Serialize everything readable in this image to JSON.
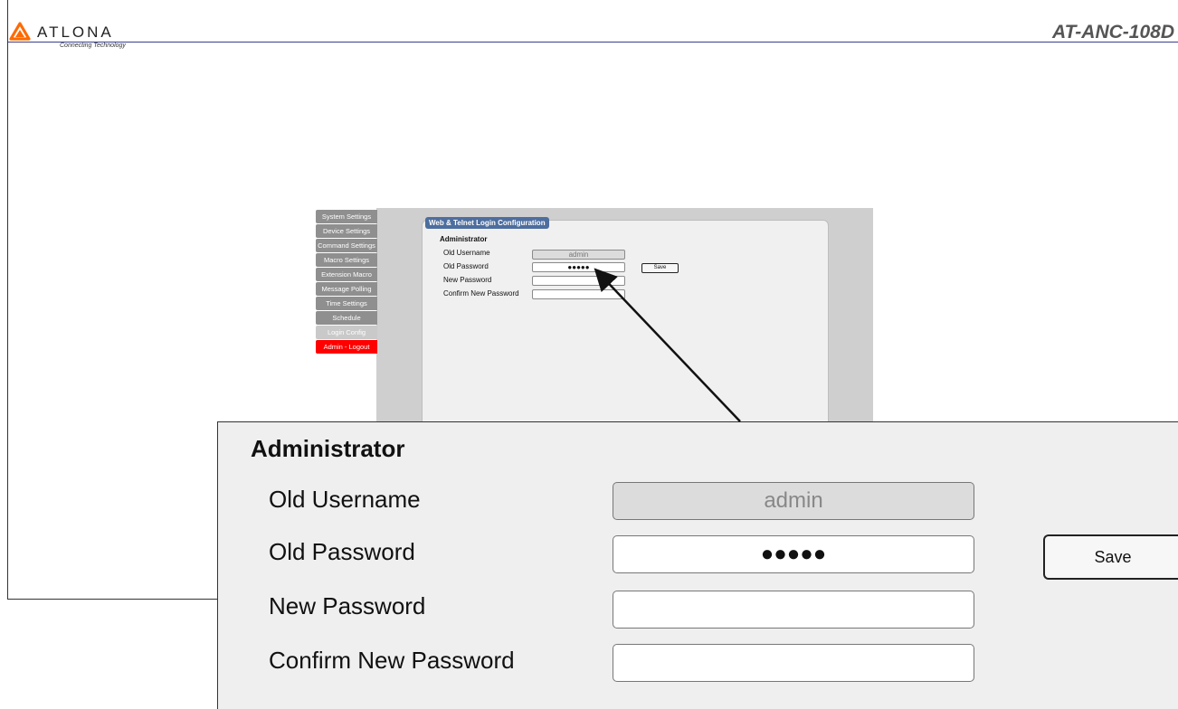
{
  "header": {
    "brand": "ATLONA",
    "tagline": "Connecting Technology",
    "model": "AT-ANC-108D",
    "accent_color": "#ff6a00"
  },
  "sidebar": {
    "items": [
      {
        "label": "System Settings"
      },
      {
        "label": "Device Settings"
      },
      {
        "label": "Command Settings"
      },
      {
        "label": "Macro Settings"
      },
      {
        "label": "Extension Macro"
      },
      {
        "label": "Message Polling"
      },
      {
        "label": "Time Settings"
      },
      {
        "label": "Schedule"
      },
      {
        "label": "Login Config"
      },
      {
        "label": "Admin - Logout"
      }
    ],
    "active": "Login Config",
    "logout_color": "#ff0000"
  },
  "panel": {
    "title": "Web & Telnet Login Configuration",
    "section": "Administrator",
    "fields": {
      "old_username_label": "Old Username",
      "old_username_value": "admin",
      "old_password_label": "Old Password",
      "old_password_value": "●●●●●",
      "new_password_label": "New Password",
      "new_password_value": "",
      "confirm_password_label": "Confirm New Password",
      "confirm_password_value": ""
    },
    "save_label": "Save"
  }
}
